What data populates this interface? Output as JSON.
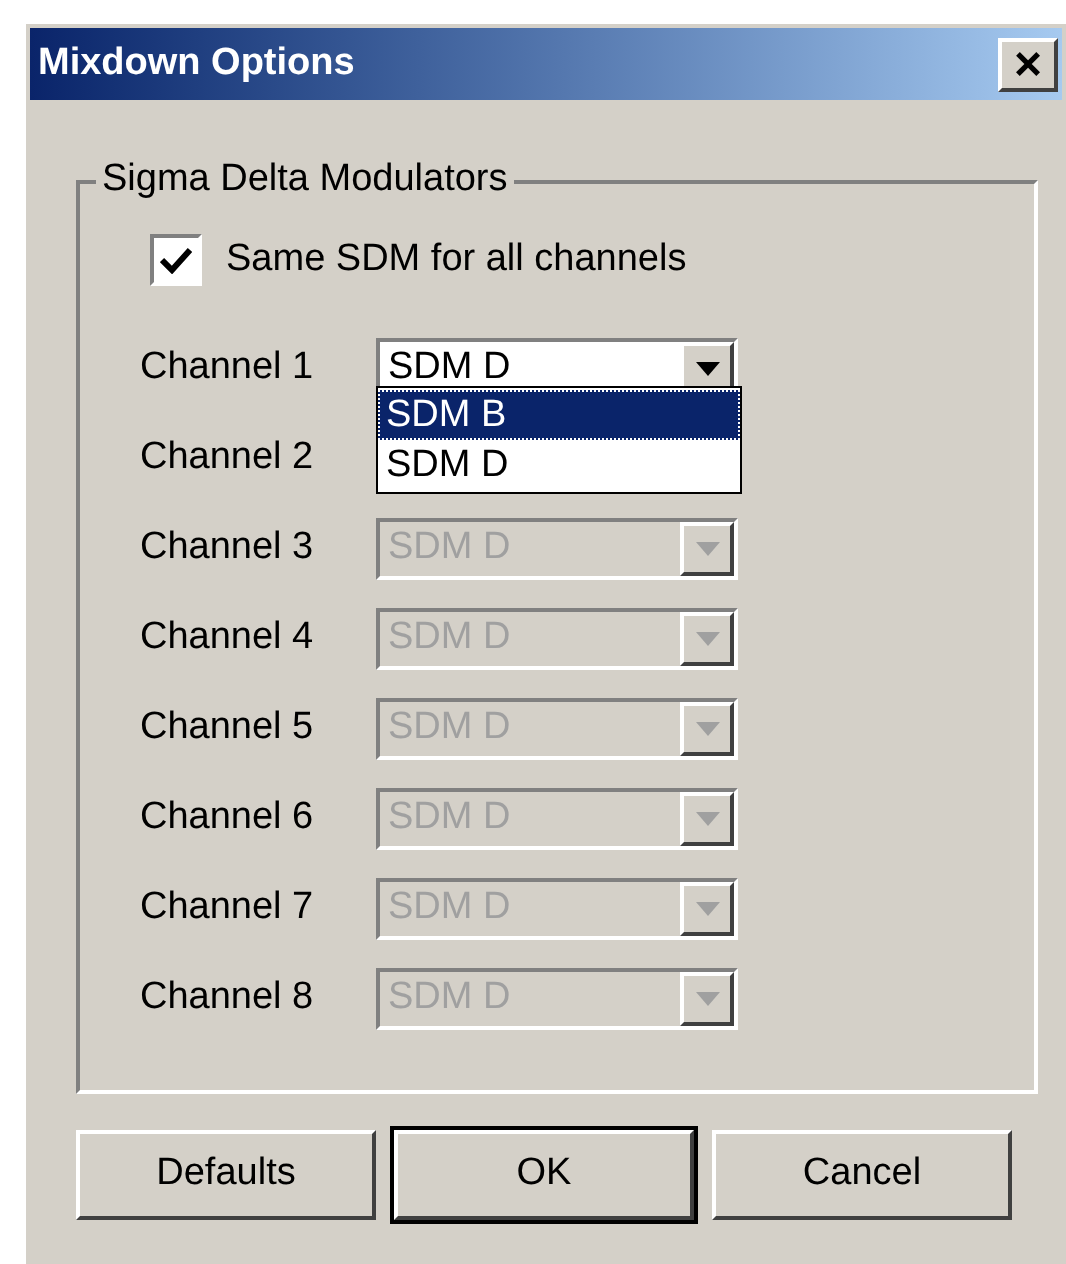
{
  "window": {
    "title": "Mixdown Options",
    "close": "×"
  },
  "group": {
    "title": "Sigma Delta Modulators",
    "same_sdm": {
      "label": "Same SDM for all channels",
      "checked": true
    },
    "channels": [
      {
        "label": "Channel 1",
        "value": "SDM D",
        "disabled": false
      },
      {
        "label": "Channel 2"
      },
      {
        "label": "Channel 3",
        "value": "SDM D",
        "disabled": true
      },
      {
        "label": "Channel 4",
        "value": "SDM D",
        "disabled": true
      },
      {
        "label": "Channel 5",
        "value": "SDM D",
        "disabled": true
      },
      {
        "label": "Channel 6",
        "value": "SDM D",
        "disabled": true
      },
      {
        "label": "Channel 7",
        "value": "SDM D",
        "disabled": true
      },
      {
        "label": "Channel 8",
        "value": "SDM D",
        "disabled": true
      }
    ],
    "dropdown_options": [
      {
        "label": "SDM B",
        "selected": true
      },
      {
        "label": "SDM D",
        "selected": false
      }
    ]
  },
  "buttons": [
    {
      "label": "Defaults",
      "default": false
    },
    {
      "label": "OK",
      "default": true
    },
    {
      "label": "Cancel",
      "default": false
    }
  ]
}
